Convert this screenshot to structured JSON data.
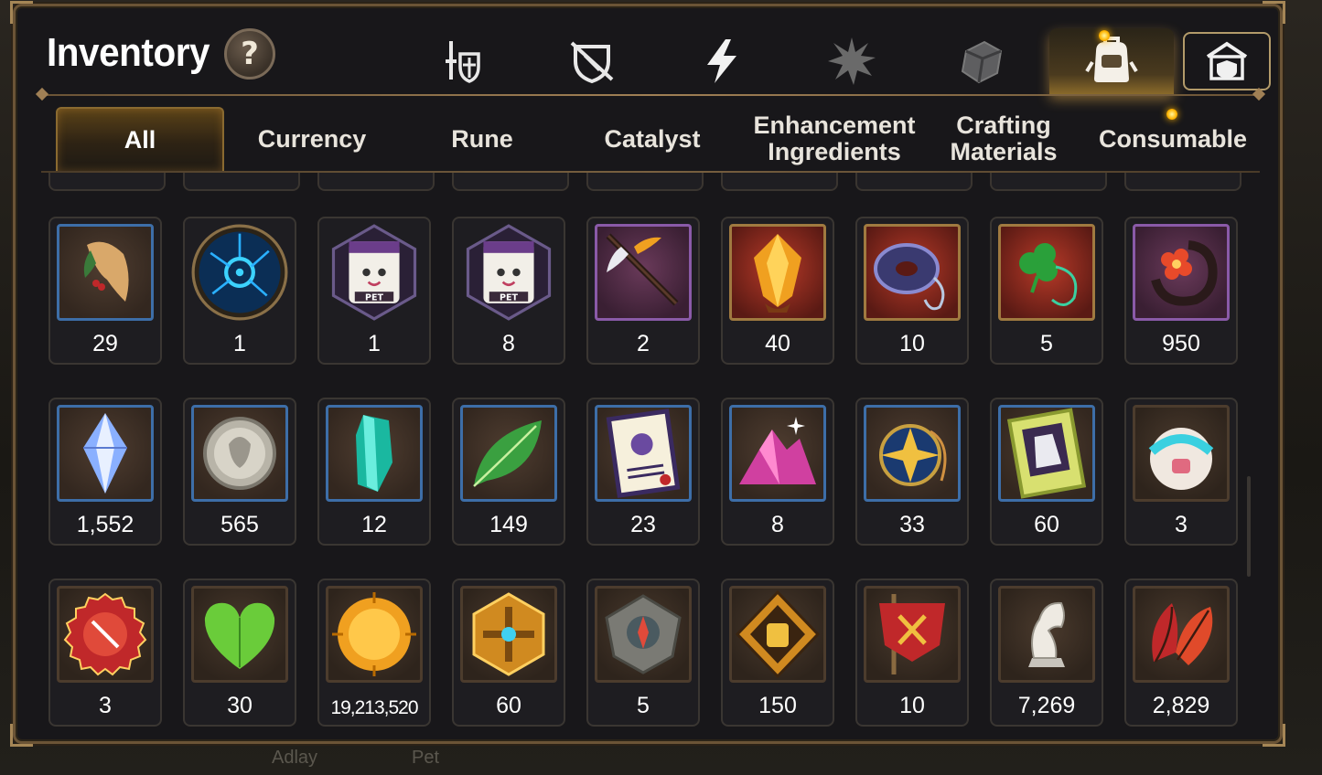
{
  "window": {
    "title": "Inventory",
    "help_label": "?"
  },
  "top_tabs": [
    {
      "name": "equipment",
      "icon": "sword-shield-icon"
    },
    {
      "name": "defense",
      "icon": "broken-shield-icon"
    },
    {
      "name": "skill",
      "icon": "lightning-icon"
    },
    {
      "name": "rage",
      "icon": "spiky-burst-icon"
    },
    {
      "name": "materials",
      "icon": "crystal-cube-icon"
    },
    {
      "name": "bag",
      "icon": "backpack-icon",
      "active": true
    },
    {
      "name": "storage",
      "icon": "storage-house-icon"
    }
  ],
  "categories": [
    {
      "label": "All",
      "active": true
    },
    {
      "label": "Currency"
    },
    {
      "label": "Rune"
    },
    {
      "label": "Catalyst"
    },
    {
      "label": "Enhancement\nIngredients"
    },
    {
      "label": "Crafting\nMaterials"
    },
    {
      "label": "Consumable"
    }
  ],
  "items": [
    {
      "icon": "ginseng-root-icon",
      "qty": "29",
      "frame": "blue"
    },
    {
      "icon": "blue-rune-orb-icon",
      "qty": "1",
      "frame": "none"
    },
    {
      "icon": "pet-food-bag-icon",
      "qty": "1",
      "frame": "none"
    },
    {
      "icon": "pet-food-bag-icon",
      "qty": "8",
      "frame": "none"
    },
    {
      "icon": "feather-wand-icon",
      "qty": "2",
      "frame": "purple"
    },
    {
      "icon": "fire-crystal-icon",
      "qty": "40",
      "frame": "red"
    },
    {
      "icon": "blue-donut-charm-icon",
      "qty": "10",
      "frame": "red"
    },
    {
      "icon": "clover-necklace-icon",
      "qty": "5",
      "frame": "red"
    },
    {
      "icon": "red-flower-ring-icon",
      "qty": "950",
      "frame": "purple"
    },
    {
      "icon": "crystal-shard-icon",
      "qty": "1,552",
      "frame": "blue"
    },
    {
      "icon": "silver-coin-icon",
      "qty": "565",
      "frame": "blue"
    },
    {
      "icon": "teal-crystal-icon",
      "qty": "12",
      "frame": "blue"
    },
    {
      "icon": "green-leaf-icon",
      "qty": "149",
      "frame": "blue"
    },
    {
      "icon": "pet-certificate-icon",
      "qty": "23",
      "frame": "blue"
    },
    {
      "icon": "pink-ore-icon",
      "qty": "8",
      "frame": "blue"
    },
    {
      "icon": "star-amulet-icon",
      "qty": "33",
      "frame": "blue"
    },
    {
      "icon": "costume-ticket-icon",
      "qty": "60",
      "frame": "blue"
    },
    {
      "icon": "robot-pod-icon",
      "qty": "3",
      "frame": "brown"
    },
    {
      "icon": "red-bottle-cap-icon",
      "qty": "3",
      "frame": "brown"
    },
    {
      "icon": "green-heart-icon",
      "qty": "30",
      "frame": "brown"
    },
    {
      "icon": "gold-sun-coin-icon",
      "qty": "19,213,520",
      "frame": "brown",
      "small": true
    },
    {
      "icon": "gold-cross-emblem-icon",
      "qty": "60",
      "frame": "brown"
    },
    {
      "icon": "stone-compass-icon",
      "qty": "5",
      "frame": "brown"
    },
    {
      "icon": "fist-emblem-icon",
      "qty": "150",
      "frame": "brown"
    },
    {
      "icon": "red-banner-icon",
      "qty": "10",
      "frame": "brown"
    },
    {
      "icon": "chess-knight-icon",
      "qty": "7,269",
      "frame": "brown"
    },
    {
      "icon": "autumn-leaf-icon",
      "qty": "2,829",
      "frame": "brown"
    }
  ],
  "background_labels": {
    "left": "Adlay",
    "right": "Pet"
  },
  "colors": {
    "accent_gold": "#b58a3a",
    "frame_blue": "#3d6ea8",
    "panel_bg": "#18171a"
  }
}
